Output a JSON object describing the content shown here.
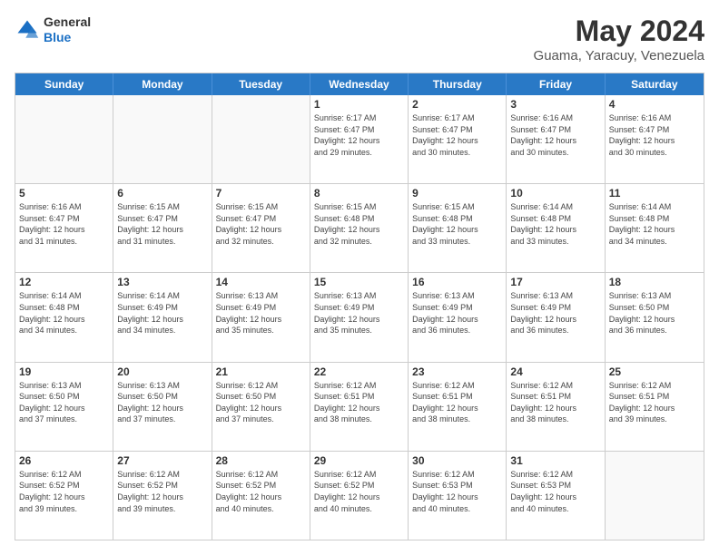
{
  "logo": {
    "general": "General",
    "blue": "Blue"
  },
  "title": "May 2024",
  "subtitle": "Guama, Yaracuy, Venezuela",
  "days": [
    "Sunday",
    "Monday",
    "Tuesday",
    "Wednesday",
    "Thursday",
    "Friday",
    "Saturday"
  ],
  "weeks": [
    [
      {
        "day": "",
        "info": ""
      },
      {
        "day": "",
        "info": ""
      },
      {
        "day": "",
        "info": ""
      },
      {
        "day": "1",
        "info": "Sunrise: 6:17 AM\nSunset: 6:47 PM\nDaylight: 12 hours\nand 29 minutes."
      },
      {
        "day": "2",
        "info": "Sunrise: 6:17 AM\nSunset: 6:47 PM\nDaylight: 12 hours\nand 30 minutes."
      },
      {
        "day": "3",
        "info": "Sunrise: 6:16 AM\nSunset: 6:47 PM\nDaylight: 12 hours\nand 30 minutes."
      },
      {
        "day": "4",
        "info": "Sunrise: 6:16 AM\nSunset: 6:47 PM\nDaylight: 12 hours\nand 30 minutes."
      }
    ],
    [
      {
        "day": "5",
        "info": "Sunrise: 6:16 AM\nSunset: 6:47 PM\nDaylight: 12 hours\nand 31 minutes."
      },
      {
        "day": "6",
        "info": "Sunrise: 6:15 AM\nSunset: 6:47 PM\nDaylight: 12 hours\nand 31 minutes."
      },
      {
        "day": "7",
        "info": "Sunrise: 6:15 AM\nSunset: 6:47 PM\nDaylight: 12 hours\nand 32 minutes."
      },
      {
        "day": "8",
        "info": "Sunrise: 6:15 AM\nSunset: 6:48 PM\nDaylight: 12 hours\nand 32 minutes."
      },
      {
        "day": "9",
        "info": "Sunrise: 6:15 AM\nSunset: 6:48 PM\nDaylight: 12 hours\nand 33 minutes."
      },
      {
        "day": "10",
        "info": "Sunrise: 6:14 AM\nSunset: 6:48 PM\nDaylight: 12 hours\nand 33 minutes."
      },
      {
        "day": "11",
        "info": "Sunrise: 6:14 AM\nSunset: 6:48 PM\nDaylight: 12 hours\nand 34 minutes."
      }
    ],
    [
      {
        "day": "12",
        "info": "Sunrise: 6:14 AM\nSunset: 6:48 PM\nDaylight: 12 hours\nand 34 minutes."
      },
      {
        "day": "13",
        "info": "Sunrise: 6:14 AM\nSunset: 6:49 PM\nDaylight: 12 hours\nand 34 minutes."
      },
      {
        "day": "14",
        "info": "Sunrise: 6:13 AM\nSunset: 6:49 PM\nDaylight: 12 hours\nand 35 minutes."
      },
      {
        "day": "15",
        "info": "Sunrise: 6:13 AM\nSunset: 6:49 PM\nDaylight: 12 hours\nand 35 minutes."
      },
      {
        "day": "16",
        "info": "Sunrise: 6:13 AM\nSunset: 6:49 PM\nDaylight: 12 hours\nand 36 minutes."
      },
      {
        "day": "17",
        "info": "Sunrise: 6:13 AM\nSunset: 6:49 PM\nDaylight: 12 hours\nand 36 minutes."
      },
      {
        "day": "18",
        "info": "Sunrise: 6:13 AM\nSunset: 6:50 PM\nDaylight: 12 hours\nand 36 minutes."
      }
    ],
    [
      {
        "day": "19",
        "info": "Sunrise: 6:13 AM\nSunset: 6:50 PM\nDaylight: 12 hours\nand 37 minutes."
      },
      {
        "day": "20",
        "info": "Sunrise: 6:13 AM\nSunset: 6:50 PM\nDaylight: 12 hours\nand 37 minutes."
      },
      {
        "day": "21",
        "info": "Sunrise: 6:12 AM\nSunset: 6:50 PM\nDaylight: 12 hours\nand 37 minutes."
      },
      {
        "day": "22",
        "info": "Sunrise: 6:12 AM\nSunset: 6:51 PM\nDaylight: 12 hours\nand 38 minutes."
      },
      {
        "day": "23",
        "info": "Sunrise: 6:12 AM\nSunset: 6:51 PM\nDaylight: 12 hours\nand 38 minutes."
      },
      {
        "day": "24",
        "info": "Sunrise: 6:12 AM\nSunset: 6:51 PM\nDaylight: 12 hours\nand 38 minutes."
      },
      {
        "day": "25",
        "info": "Sunrise: 6:12 AM\nSunset: 6:51 PM\nDaylight: 12 hours\nand 39 minutes."
      }
    ],
    [
      {
        "day": "26",
        "info": "Sunrise: 6:12 AM\nSunset: 6:52 PM\nDaylight: 12 hours\nand 39 minutes."
      },
      {
        "day": "27",
        "info": "Sunrise: 6:12 AM\nSunset: 6:52 PM\nDaylight: 12 hours\nand 39 minutes."
      },
      {
        "day": "28",
        "info": "Sunrise: 6:12 AM\nSunset: 6:52 PM\nDaylight: 12 hours\nand 40 minutes."
      },
      {
        "day": "29",
        "info": "Sunrise: 6:12 AM\nSunset: 6:52 PM\nDaylight: 12 hours\nand 40 minutes."
      },
      {
        "day": "30",
        "info": "Sunrise: 6:12 AM\nSunset: 6:53 PM\nDaylight: 12 hours\nand 40 minutes."
      },
      {
        "day": "31",
        "info": "Sunrise: 6:12 AM\nSunset: 6:53 PM\nDaylight: 12 hours\nand 40 minutes."
      },
      {
        "day": "",
        "info": ""
      }
    ]
  ]
}
